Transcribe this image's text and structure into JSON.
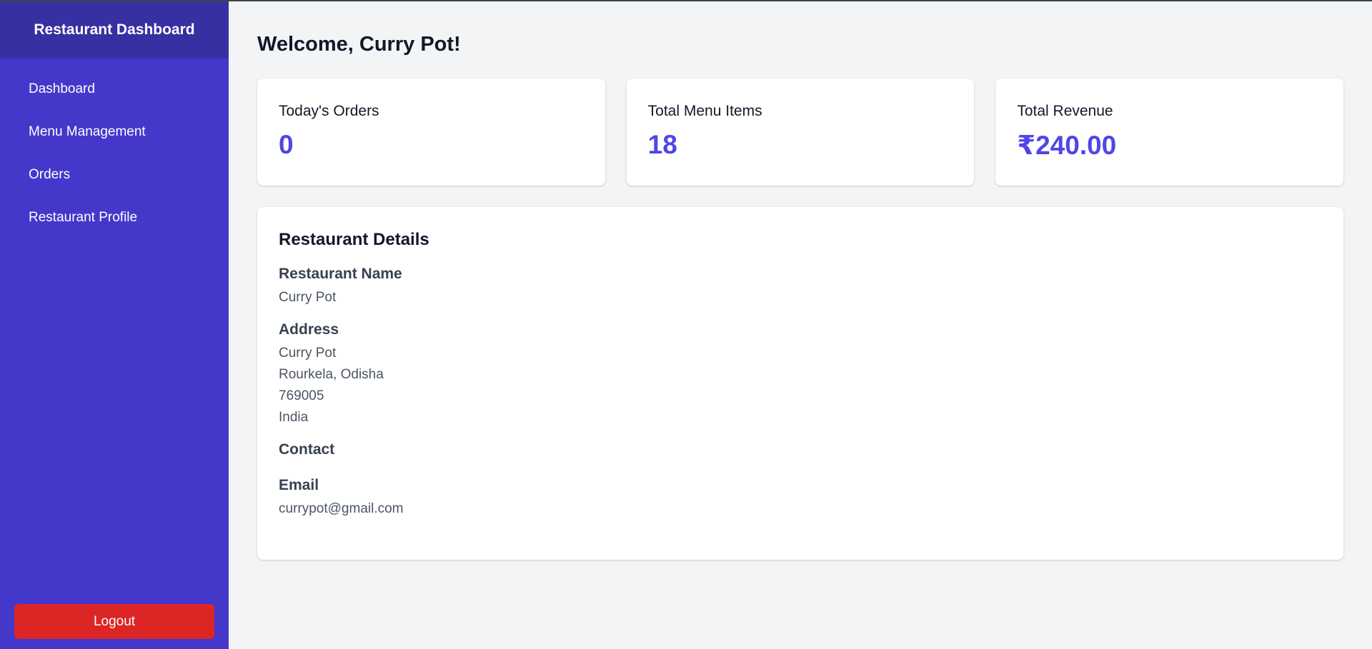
{
  "sidebar": {
    "title": "Restaurant Dashboard",
    "items": [
      {
        "label": "Dashboard"
      },
      {
        "label": "Menu Management"
      },
      {
        "label": "Orders"
      },
      {
        "label": "Restaurant Profile"
      }
    ],
    "logout_label": "Logout"
  },
  "main": {
    "welcome": "Welcome, Curry Pot!",
    "stats": [
      {
        "label": "Today's Orders",
        "value": "0"
      },
      {
        "label": "Total Menu Items",
        "value": "18"
      },
      {
        "label": "Total Revenue",
        "value": "₹240.00"
      }
    ],
    "details": {
      "title": "Restaurant Details",
      "name_label": "Restaurant Name",
      "name_value": "Curry Pot",
      "address_label": "Address",
      "address_lines": [
        "Curry Pot",
        "Rourkela, Odisha",
        "769005",
        "India"
      ],
      "contact_label": "Contact",
      "email_label": "Email",
      "email_value": "currypot@gmail.com"
    }
  },
  "colors": {
    "sidebar": "#4338ca",
    "sidebar_header": "#3730a3",
    "accent": "#4f46e5",
    "logout": "#dc2626",
    "background": "#f3f4f6"
  }
}
